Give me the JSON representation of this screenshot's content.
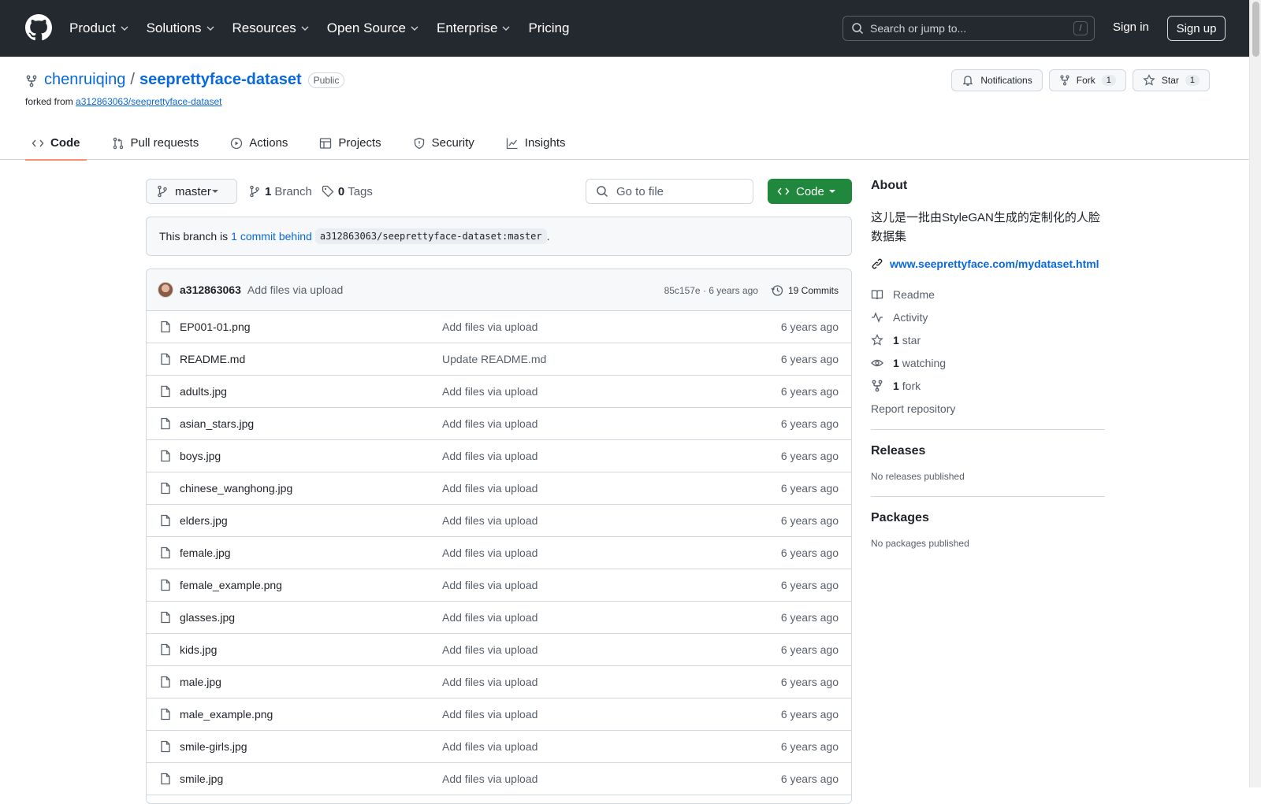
{
  "header": {
    "nav": [
      {
        "label": "Product",
        "has_menu": true
      },
      {
        "label": "Solutions",
        "has_menu": true
      },
      {
        "label": "Resources",
        "has_menu": true
      },
      {
        "label": "Open Source",
        "has_menu": true
      },
      {
        "label": "Enterprise",
        "has_menu": true
      },
      {
        "label": "Pricing",
        "has_menu": false
      }
    ],
    "search_placeholder": "Search or jump to...",
    "search_shortcut": "/",
    "signin": "Sign in",
    "signup": "Sign up"
  },
  "repo": {
    "owner": "chenruiqing",
    "separator": "/",
    "name": "seeprettyface-dataset",
    "visibility": "Public",
    "forked_prefix": "forked from",
    "forked_from": "a312863063/seeprettyface-dataset",
    "actions": {
      "notifications": "Notifications",
      "fork": "Fork",
      "fork_count": "1",
      "star": "Star",
      "star_count": "1"
    },
    "tabs": [
      {
        "label": "Code",
        "icon": "code-icon",
        "active": true
      },
      {
        "label": "Pull requests",
        "icon": "pull-request-icon",
        "active": false
      },
      {
        "label": "Actions",
        "icon": "play-icon",
        "active": false
      },
      {
        "label": "Projects",
        "icon": "table-icon",
        "active": false
      },
      {
        "label": "Security",
        "icon": "shield-icon",
        "active": false
      },
      {
        "label": "Insights",
        "icon": "graph-icon",
        "active": false
      }
    ]
  },
  "toolbar": {
    "branch": "master",
    "branch_count": "1",
    "branch_label": "Branch",
    "tag_count": "0",
    "tag_label": "Tags",
    "go_to_file": "Go to file",
    "code_button": "Code"
  },
  "behind": {
    "prefix": "This branch is",
    "link": "1 commit behind",
    "ref": "a312863063/seeprettyface-dataset:master",
    "suffix": "."
  },
  "commit": {
    "author": "a312863063",
    "message": "Add files via upload",
    "hash_time": "85c157e · 6 years ago",
    "commits_label": "19 Commits"
  },
  "files": [
    {
      "name": "EP001-01.png",
      "message": "Add files via upload",
      "date": "6 years ago"
    },
    {
      "name": "README.md",
      "message": "Update README.md",
      "date": "6 years ago"
    },
    {
      "name": "adults.jpg",
      "message": "Add files via upload",
      "date": "6 years ago"
    },
    {
      "name": "asian_stars.jpg",
      "message": "Add files via upload",
      "date": "6 years ago"
    },
    {
      "name": "boys.jpg",
      "message": "Add files via upload",
      "date": "6 years ago"
    },
    {
      "name": "chinese_wanghong.jpg",
      "message": "Add files via upload",
      "date": "6 years ago"
    },
    {
      "name": "elders.jpg",
      "message": "Add files via upload",
      "date": "6 years ago"
    },
    {
      "name": "female.jpg",
      "message": "Add files via upload",
      "date": "6 years ago"
    },
    {
      "name": "female_example.png",
      "message": "Add files via upload",
      "date": "6 years ago"
    },
    {
      "name": "glasses.jpg",
      "message": "Add files via upload",
      "date": "6 years ago"
    },
    {
      "name": "kids.jpg",
      "message": "Add files via upload",
      "date": "6 years ago"
    },
    {
      "name": "male.jpg",
      "message": "Add files via upload",
      "date": "6 years ago"
    },
    {
      "name": "male_example.png",
      "message": "Add files via upload",
      "date": "6 years ago"
    },
    {
      "name": "smile-girls.jpg",
      "message": "Add files via upload",
      "date": "6 years ago"
    },
    {
      "name": "smile.jpg",
      "message": "Add files via upload",
      "date": "6 years ago"
    }
  ],
  "about": {
    "title": "About",
    "description": "这儿是一批由StyleGAN生成的定制化的人脸数据集",
    "website": "www.seeprettyface.com/mydataset.html",
    "readme": "Readme",
    "activity": "Activity",
    "stars_count": "1",
    "stars_label": "star",
    "watching_count": "1",
    "watching_label": "watching",
    "forks_count": "1",
    "forks_label": "fork",
    "report": "Report repository"
  },
  "releases": {
    "title": "Releases",
    "note": "No releases published"
  },
  "packages": {
    "title": "Packages",
    "note": "No packages published"
  },
  "colors": {
    "header_bg": "#24292f",
    "link": "#0969da",
    "code_button": "#1f883d",
    "active_tab_underline": "#fd8c73"
  }
}
